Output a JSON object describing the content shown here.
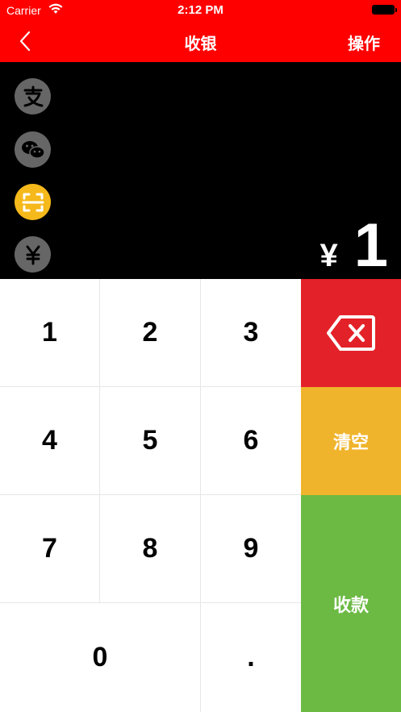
{
  "status_bar": {
    "carrier": "Carrier",
    "time": "2:12 PM"
  },
  "nav": {
    "back_icon": "chevron-left-icon",
    "title": "收银",
    "action": "操作"
  },
  "payment_methods": [
    {
      "name": "alipay",
      "icon": "alipay-icon",
      "active": false
    },
    {
      "name": "wechat",
      "icon": "wechat-icon",
      "active": false
    },
    {
      "name": "scan",
      "icon": "scan-icon",
      "active": true
    },
    {
      "name": "cash",
      "icon": "yuan-icon",
      "active": false
    }
  ],
  "display": {
    "currency": "¥",
    "amount": "1"
  },
  "keypad": {
    "k1": "1",
    "k2": "2",
    "k3": "3",
    "k4": "4",
    "k5": "5",
    "k6": "6",
    "k7": "7",
    "k8": "8",
    "k9": "9",
    "k0": "0",
    "kdot": "."
  },
  "actions": {
    "backspace_icon": "backspace-icon",
    "clear": "清空",
    "collect": "收款"
  },
  "colors": {
    "nav_bg": "#ff0000",
    "display_bg": "#000000",
    "icon_inactive": "#666666",
    "icon_active": "#f6b91b",
    "backspace_bg": "#e32128",
    "clear_bg": "#f0b42c",
    "collect_bg": "#6cba44"
  }
}
